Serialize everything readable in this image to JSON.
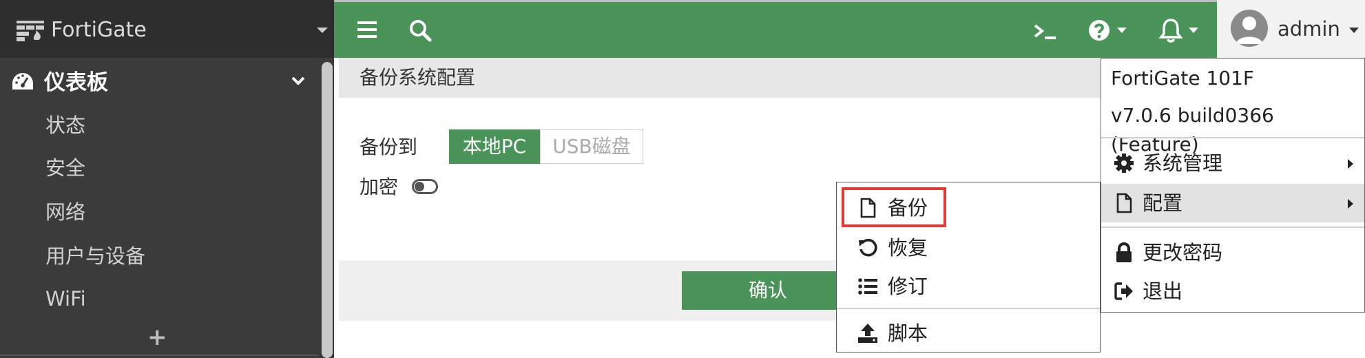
{
  "sidebar": {
    "brand": "FortiGate",
    "section": "仪表板",
    "items": [
      "状态",
      "安全",
      "网络",
      "用户与设备",
      "WiFi"
    ],
    "add_label": "+"
  },
  "topbar": {
    "user": "admin"
  },
  "main": {
    "title": "备份系统配置",
    "backup_to_label": "备份到",
    "options": [
      "本地PC",
      "USB磁盘"
    ],
    "encrypt_label": "加密",
    "confirm_label": "确认"
  },
  "config_menu": {
    "items": [
      "备份",
      "恢复",
      "修订",
      "脚本"
    ]
  },
  "admin_menu": {
    "model": "FortiGate 101F",
    "version": "v7.0.6 build0366 (Feature)",
    "system": "系统管理",
    "config": "配置",
    "change_password": "更改密码",
    "logout": "退出"
  },
  "colors": {
    "accent_green": "#4a9359",
    "sidebar_bg": "#3b3b3b",
    "highlight_red": "#e53935"
  }
}
